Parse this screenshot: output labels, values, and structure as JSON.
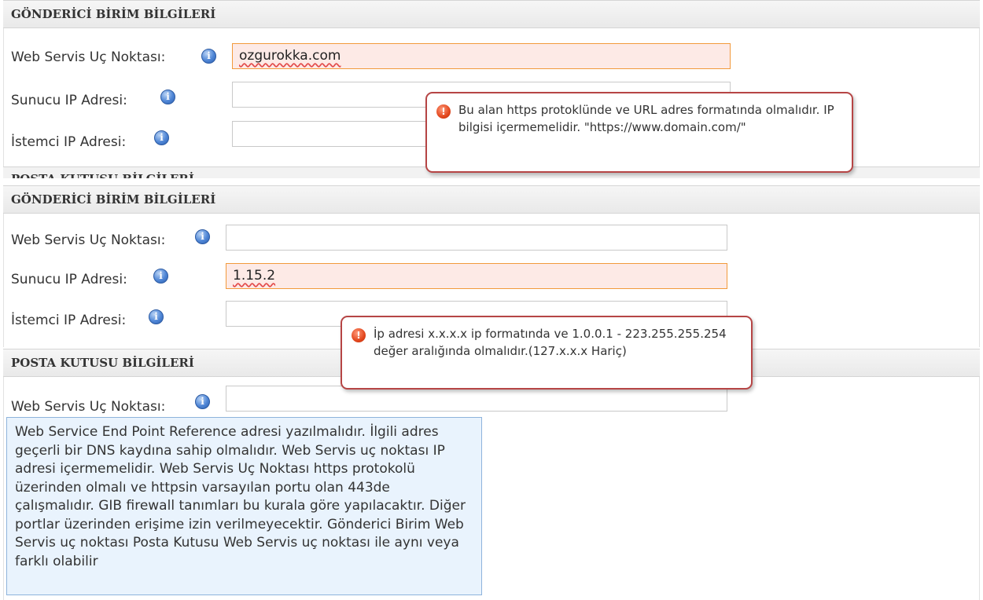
{
  "section1": {
    "title": "GÖNDERİCİ BİRİM BİLGİLERİ",
    "web_label": "Web Servis Uç Noktası:",
    "web_value": "ozgurokka.com",
    "server_label": "Sunucu IP Adresi:",
    "client_label": "İstemci IP Adresi:",
    "error_text": "Bu alan https protoklünde ve URL adres formatında olmalıdır. IP bilgisi içermemelidir. \"https://www.domain.com/\""
  },
  "section2": {
    "title": "GÖNDERİCİ BİRİM BİLGİLERİ",
    "web_label": "Web Servis Uç Noktası:",
    "server_label": "Sunucu IP Adresi:",
    "server_value": "1.15.2",
    "client_label": "İstemci IP Adresi:",
    "error_text": "İp adresi x.x.x.x ip formatında ve 1.0.0.1 - 223.255.255.254 değer aralığında olmalıdır.(127.x.x.x Hariç)"
  },
  "section3": {
    "title": "POSTA KUTUSU BİLGİLERİ",
    "web_label": "Web Servis Uç Noktası:",
    "help_text": "Web Service End Point Reference adresi yazılmalıdır. İlgili adres geçerli bir DNS kaydına sahip olmalıdır. Web Servis uç noktası IP adresi içermemelidir. Web Servis Uç Noktası https protokolü üzerinden olmalı ve httpsin varsayılan portu olan 443de çalışmalıdır. GIB firewall tanımları bu kurala göre yapılacaktır. Diğer portlar üzerinden erişime izin verilmeyecektir. Gönderici Birim Web Servis uç noktası Posta Kutusu Web Servis uç noktası ile aynı veya farklı olabilir"
  },
  "icons": {
    "info": "info-icon",
    "error": "error-icon"
  },
  "colors": {
    "error_border": "#b64545",
    "error_field_bg": "#fdeae6",
    "help_bg": "#e9f3fd"
  }
}
